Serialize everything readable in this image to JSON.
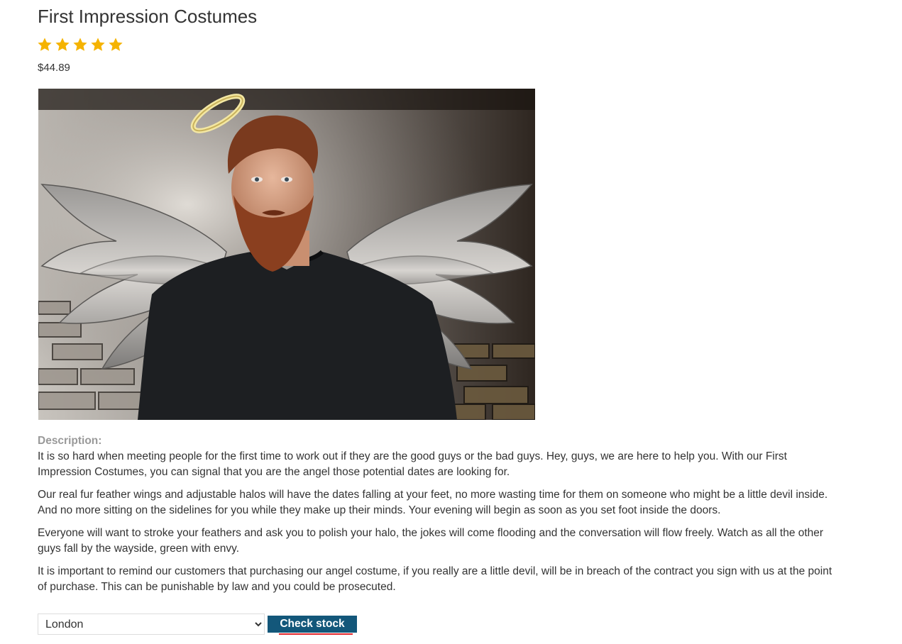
{
  "product": {
    "title": "First Impression Costumes",
    "rating": 5,
    "rating_max": 5,
    "star_color": "#f5b301",
    "price": "$44.89"
  },
  "description": {
    "label": "Description:",
    "paragraphs": [
      "It is so hard when meeting people for the first time to work out if they are the good guys or the bad guys. Hey, guys, we are here to help you. With our First Impression Costumes, you can signal that you are the angel those potential dates are looking for.",
      "Our real fur feather wings and adjustable halos will have the dates falling at your feet, no more wasting time for them on someone who might be a little devil inside. And no more sitting on the sidelines for you while they make up their minds. Your evening will begin as soon as you set foot inside the doors.",
      "Everyone will want to stroke your feathers and ask you to polish your halo, the jokes will come flooding and the conversation will flow freely. Watch as all the other guys fall by the wayside, green with envy.",
      "It is important to remind our customers that purchasing our angel costume, if you really are a little devil, will be in breach of the contract you sign with us at the point of purchase. This can be punishable by law and you could be prosecuted."
    ]
  },
  "stock_check": {
    "selected_store": "London",
    "button_label": "Check stock",
    "button_color": "#13577a",
    "accent_color": "#e3262b"
  },
  "icons": {
    "rating": "star-icon"
  }
}
